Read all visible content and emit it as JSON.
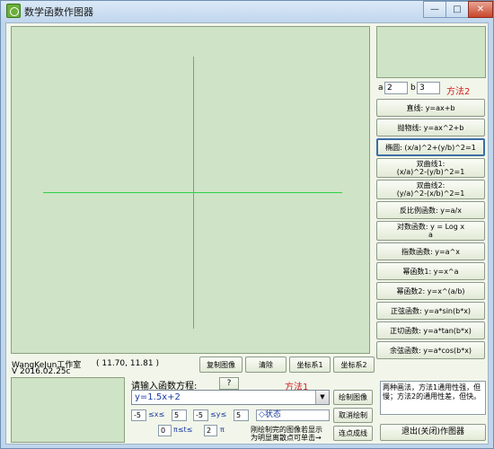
{
  "window": {
    "title": "数学函数作图器",
    "minimize_glyph": "—",
    "maximize_glyph": "□",
    "close_glyph": "✕"
  },
  "params": {
    "a_label": "a",
    "a_value": "2",
    "b_label": "b",
    "b_value": "3",
    "method_label": "方法2"
  },
  "function_buttons": [
    {
      "label": "直线: y=ax+b"
    },
    {
      "label": "抛物线: y=ax^2+b"
    },
    {
      "label": "椭圆: (x/a)^2+(y/b)^2=1"
    },
    {
      "label": "双曲线1:\n(x/a)^2-(y/b)^2=1"
    },
    {
      "label": "双曲线2:\n(y/a)^2-(x/b)^2=1"
    },
    {
      "label": "反比例函数: y=a/x"
    },
    {
      "label": "对数函数: y = Log  x\n                           a"
    },
    {
      "label": "指数函数: y=a^x"
    },
    {
      "label": "幂函数1: y=x^a"
    },
    {
      "label": "幂函数2: y=x^(a/b)"
    },
    {
      "label": "正弦函数: y=a*sin(b*x)"
    },
    {
      "label": "正切函数: y=a*tan(b*x)"
    },
    {
      "label": "余弦函数: y=a*cos(b*x)"
    }
  ],
  "status": {
    "author": "WangKeJun工作室",
    "version": "V 2016.02.25c",
    "coordinates": "( 11.70, 11.81 )"
  },
  "toolbar": {
    "copy_label": "复制图像",
    "clear_label": "清除",
    "coord1_label": "坐标系1",
    "coord2_label": "坐标系2"
  },
  "input_area": {
    "prompt": "请输入函数方程:",
    "help_label": "?",
    "method_label": "方法1",
    "function_value": "y=1.5x+2",
    "x_min": "-5",
    "x_range_label": "≤x≤",
    "x_max": "5",
    "y_min": "-5",
    "y_range_label": "≤y≤",
    "y_max": "5",
    "status_label": "◇状态",
    "t_min": "0",
    "t_range_label": "π≤t≤",
    "t_max": "2",
    "t_unit": "π",
    "hint_line1": "刚绘制完的图像若显示",
    "hint_line2": "为明显离散点可单击→",
    "draw_label": "绘制图像",
    "cancel_label": "取消绘制",
    "connect_label": "连点成线"
  },
  "notes": {
    "text": "两种画法，方法1通用性强，但慢；方法2的通用性差，但快。"
  },
  "exit_label": "退出(关闭)作图器"
}
